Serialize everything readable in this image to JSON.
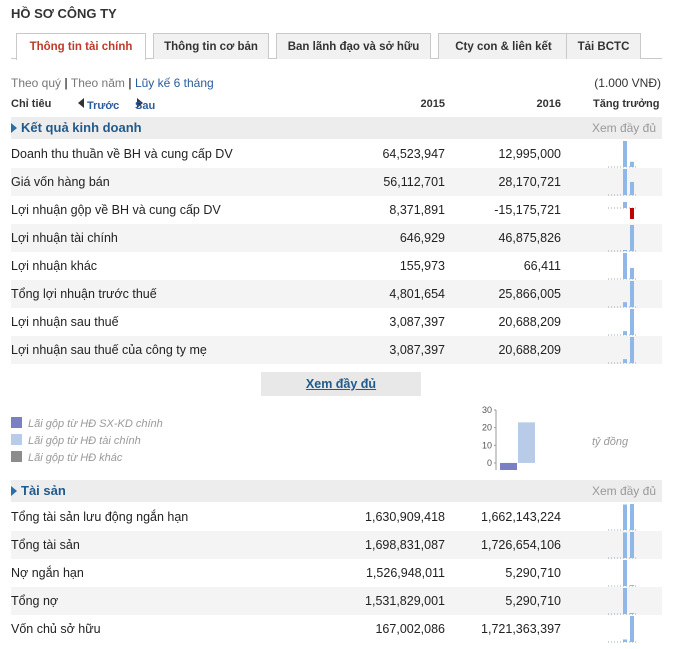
{
  "page": {
    "title": "HỒ SƠ CÔNG TY"
  },
  "tabs": [
    {
      "label": "Thông tin tài chính",
      "active": true
    },
    {
      "label": "Thông tin cơ bản",
      "active": false
    },
    {
      "label": "Ban lãnh đạo và sở hữu",
      "active": false
    },
    {
      "label": "Cty con & liên kết",
      "active": false
    },
    {
      "label": "Tải BCTC",
      "active": false
    }
  ],
  "period": {
    "quarter": "Theo quý",
    "sep1": "|",
    "year": "Theo năm",
    "sep2": "|",
    "cumulative": "Lũy kế 6 tháng"
  },
  "unit": "(1.000 VNĐ)",
  "header": {
    "indicator": "Chỉ tiêu",
    "prev": "Trước",
    "next": "Sau",
    "year1": "2015",
    "year2": "2016",
    "growth": "Tăng trưởng"
  },
  "sections": {
    "income": {
      "title": "Kết quả kinh doanh",
      "more": "Xem đầy đủ"
    },
    "assets": {
      "title": "Tài sản",
      "more": "Xem đầy đủ"
    }
  },
  "income_rows": [
    {
      "label": "Doanh thu thuần về BH và cung cấp DV",
      "v2015": "64,523,947",
      "v2016": "12,995,000",
      "spark": [
        64523947,
        12995000
      ]
    },
    {
      "label": "Giá vốn hàng bán",
      "v2015": "56,112,701",
      "v2016": "28,170,721",
      "spark": [
        56112701,
        28170721
      ]
    },
    {
      "label": "Lợi nhuận gộp về BH và cung cấp DV",
      "v2015": "8,371,891",
      "v2016": "-15,175,721",
      "spark": [
        8371891,
        -15175721
      ]
    },
    {
      "label": "Lợi nhuận tài chính",
      "v2015": "646,929",
      "v2016": "46,875,826",
      "spark": [
        646929,
        46875826
      ]
    },
    {
      "label": "Lợi nhuận khác",
      "v2015": "155,973",
      "v2016": "66,411",
      "spark": [
        155973,
        66411
      ]
    },
    {
      "label": "Tổng lợi nhuận trước thuế",
      "v2015": "4,801,654",
      "v2016": "25,866,005",
      "spark": [
        4801654,
        25866005
      ]
    },
    {
      "label": "Lợi nhuận sau thuế",
      "v2015": "3,087,397",
      "v2016": "20,688,209",
      "spark": [
        3087397,
        20688209
      ]
    },
    {
      "label": "Lợi nhuận sau thuế của công ty mẹ",
      "v2015": "3,087,397",
      "v2016": "20,688,209",
      "spark": [
        3087397,
        20688209
      ]
    }
  ],
  "more_button": "Xem đầy đủ",
  "legend": [
    {
      "label": "Lãi gộp từ HĐ SX-KD chính",
      "color": "#7b7fc4"
    },
    {
      "label": "Lãi gộp từ HĐ tài chính",
      "color": "#b8cbe8"
    },
    {
      "label": "Lãi gộp từ HĐ khác",
      "color": "#8c8c8c"
    }
  ],
  "chart_data": {
    "type": "bar",
    "ylim": [
      -4,
      30
    ],
    "yticks": [
      "30",
      "20",
      "10",
      "0"
    ],
    "unit_label": "tỷ đồng",
    "series": [
      {
        "name": "Lãi gộp từ HĐ SX-KD chính",
        "values": [
          -4
        ]
      },
      {
        "name": "Lãi gộp từ HĐ tài chính",
        "values": [
          23
        ]
      }
    ]
  },
  "asset_rows": [
    {
      "label": "Tổng tài sản lưu động ngắn hạn",
      "v2015": "1,630,909,418",
      "v2016": "1,662,143,224",
      "spark": [
        1630909418,
        1662143224
      ]
    },
    {
      "label": "Tổng tài sản",
      "v2015": "1,698,831,087",
      "v2016": "1,726,654,106",
      "spark": [
        1698831087,
        1726654106
      ]
    },
    {
      "label": "Nợ ngắn hạn",
      "v2015": "1,526,948,011",
      "v2016": "5,290,710",
      "spark": [
        1526948011,
        5290710
      ]
    },
    {
      "label": "Tổng nợ",
      "v2015": "1,531,829,001",
      "v2016": "5,290,710",
      "spark": [
        1531829001,
        5290710
      ]
    },
    {
      "label": "Vốn chủ sở hữu",
      "v2015": "167,002,086",
      "v2016": "1,721,363,397",
      "spark": [
        167002086,
        1721363397
      ]
    }
  ],
  "colors": {
    "accent": "#c0392b",
    "link": "#1f5a8c",
    "spark_pos": "#8fb8e8",
    "spark_neg": "#c00000"
  }
}
